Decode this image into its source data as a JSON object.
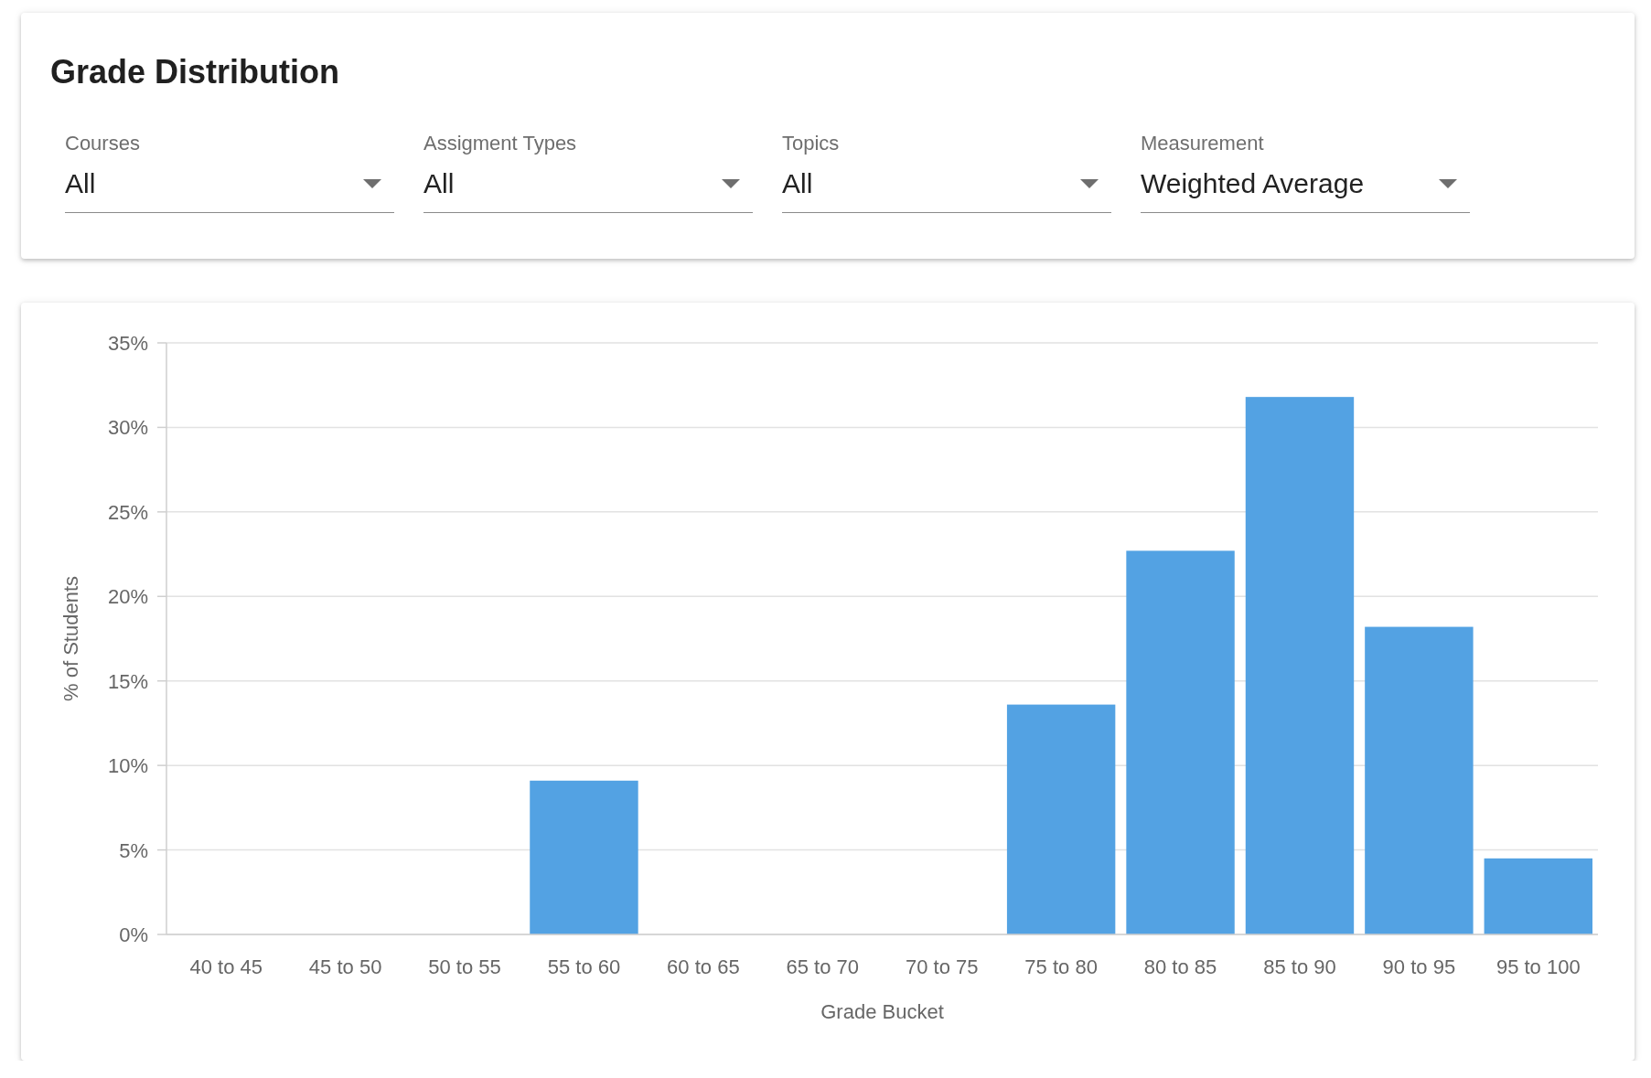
{
  "filters_card": {
    "title": "Grade Distribution",
    "filters": [
      {
        "label": "Courses",
        "value": "All"
      },
      {
        "label": "Assigment Types",
        "value": "All"
      },
      {
        "label": "Topics",
        "value": "All"
      },
      {
        "label": "Measurement",
        "value": "Weighted Average"
      }
    ]
  },
  "chart_card": {
    "chart_data": {
      "type": "bar",
      "xlabel": "Grade Bucket",
      "ylabel": "% of Students",
      "categories": [
        "40 to 45",
        "45 to 50",
        "50 to 55",
        "55 to 60",
        "60 to 65",
        "65 to 70",
        "70 to 75",
        "75 to 80",
        "80 to 85",
        "85 to 90",
        "90 to 95",
        "95 to 100"
      ],
      "grid": true,
      "series": [
        {
          "color": "#53a2e3",
          "values": [
            0,
            0,
            0,
            9.1,
            0,
            0,
            0,
            13.6,
            22.7,
            31.8,
            18.2,
            4.5
          ]
        }
      ],
      "ylim": [
        0,
        35
      ],
      "yticks": [
        {
          "value": 0,
          "label": "0%"
        },
        {
          "value": 5,
          "label": "5%"
        },
        {
          "value": 10,
          "label": "10%"
        },
        {
          "value": 15,
          "label": "15%"
        },
        {
          "value": 20,
          "label": "20%"
        },
        {
          "value": 25,
          "label": "25%"
        },
        {
          "value": 30,
          "label": "30%"
        },
        {
          "value": 35,
          "label": "35%"
        }
      ]
    }
  }
}
